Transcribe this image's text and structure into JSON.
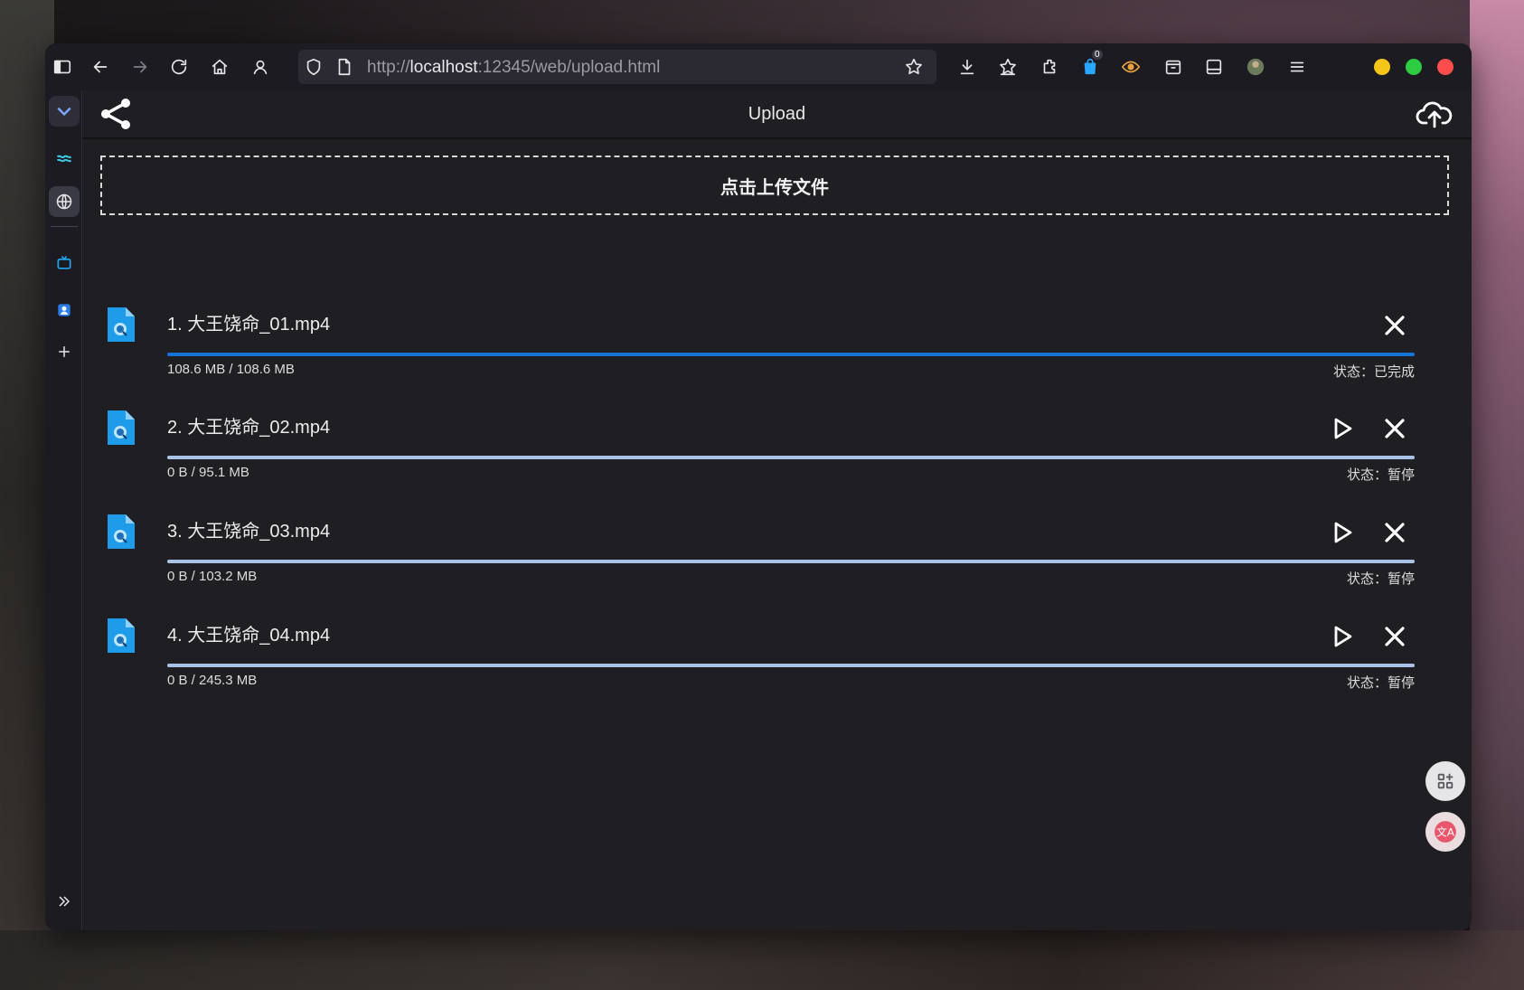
{
  "browser": {
    "url_prefix": "http://",
    "url_host": "localhost",
    "url_rest": ":12345/web/upload.html",
    "extension_badge": "0"
  },
  "app": {
    "title": "Upload",
    "dropzone_label": "点击上传文件"
  },
  "files": [
    {
      "name": "1. 大王饶命_01.mp4",
      "size": "108.6 MB / 108.6 MB",
      "status": "状态：已完成",
      "progress": 1.0
    },
    {
      "name": "2. 大王饶命_02.mp4",
      "size": "0 B / 95.1 MB",
      "status": "状态：暂停",
      "progress": 0
    },
    {
      "name": "3. 大王饶命_03.mp4",
      "size": "0 B / 103.2 MB",
      "status": "状态：暂停",
      "progress": 0
    },
    {
      "name": "4. 大王饶命_04.mp4",
      "size": "0 B / 245.3 MB",
      "status": "状态：暂停",
      "progress": 0
    }
  ],
  "colors": {
    "progress_fill": "#1a73d9",
    "progress_track": "#a9c3e6",
    "window_min": "#f5c518",
    "window_max": "#2ecc40",
    "window_close": "#ff4d4d"
  }
}
